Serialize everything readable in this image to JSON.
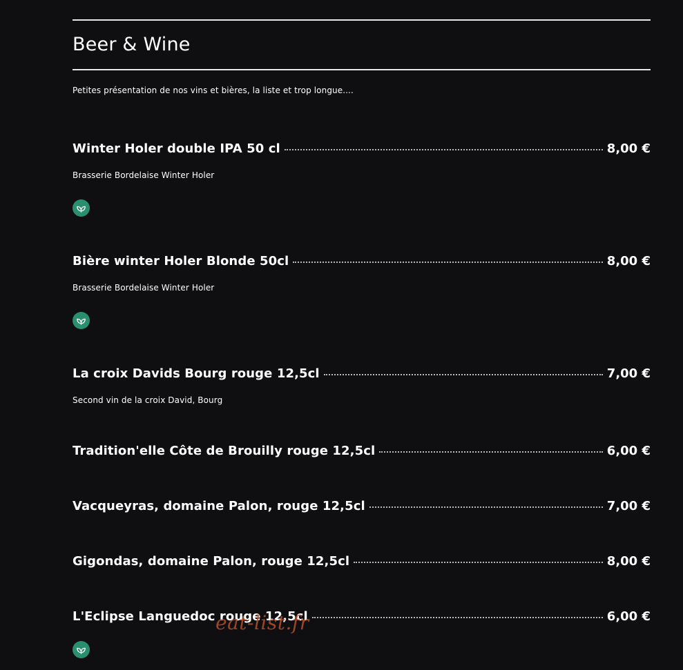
{
  "section": {
    "title": "Beer & Wine",
    "intro": "Petites présentation de nos vins et bières, la liste et trop longue...."
  },
  "items": [
    {
      "name": "Winter Holer double IPA 50 cl",
      "price": "8,00 €",
      "description": "Brasserie Bordelaise Winter Holer",
      "badge_icon": "leaf-icon"
    },
    {
      "name": "Bière winter Holer Blonde 50cl",
      "price": "8,00 €",
      "description": "Brasserie Bordelaise Winter Holer",
      "badge_icon": "leaf-icon"
    },
    {
      "name": "La croix Davids Bourg rouge 12,5cl",
      "price": "7,00 €",
      "description": "Second vin de la croix David, Bourg"
    },
    {
      "name": "Tradition'elle Côte de Brouilly rouge 12,5cl",
      "price": "6,00 €"
    },
    {
      "name": "Vacqueyras, domaine Palon, rouge 12,5cl",
      "price": "7,00 €"
    },
    {
      "name": "Gigondas, domaine Palon, rouge 12,5cl",
      "price": "8,00 €"
    },
    {
      "name": "L'Eclipse Languedoc rouge 12,5cl",
      "price": "6,00 €",
      "badge_icon": "leaf-icon"
    }
  ],
  "watermark": "eat-list.fr",
  "colors": {
    "background": "#0f0f12",
    "text": "#ffffff",
    "badge": "#2a8f6f",
    "watermark": "#b5502b"
  }
}
